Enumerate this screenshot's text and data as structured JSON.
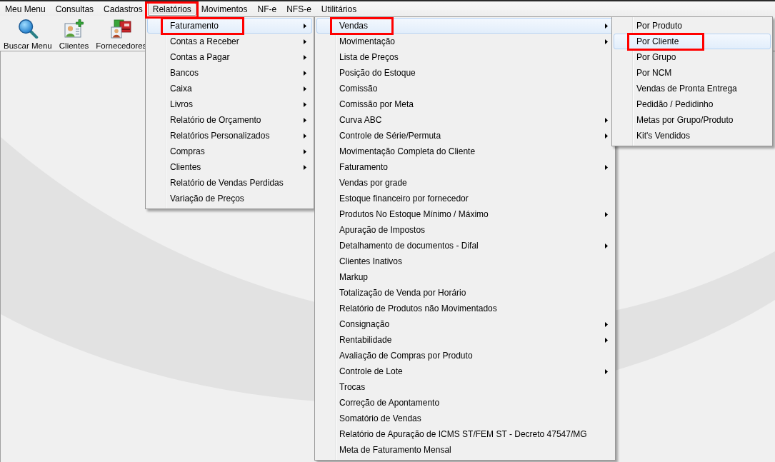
{
  "menu_bar": [
    {
      "label": "Meu Menu",
      "selected": false,
      "annotated": false
    },
    {
      "label": "Consultas",
      "selected": false,
      "annotated": false
    },
    {
      "label": "Cadastros",
      "selected": false,
      "annotated": false
    },
    {
      "label": "Relatórios",
      "selected": true,
      "annotated": true
    },
    {
      "label": "Movimentos",
      "selected": false,
      "annotated": false
    },
    {
      "label": "NF-e",
      "selected": false,
      "annotated": false
    },
    {
      "label": "NFS-e",
      "selected": false,
      "annotated": false
    },
    {
      "label": "Utilitários",
      "selected": false,
      "annotated": false
    }
  ],
  "toolbar": [
    {
      "label": "Buscar Menu",
      "kind": "search"
    },
    {
      "label": "Clientes",
      "kind": "client"
    },
    {
      "label": "Fornecedores",
      "kind": "supplier"
    }
  ],
  "menus": [
    {
      "items": [
        {
          "label": "Faturamento",
          "selected": true,
          "submenu": true,
          "annotated": true
        },
        {
          "label": "Contas a Receber",
          "selected": false,
          "submenu": true,
          "annotated": false
        },
        {
          "label": "Contas a Pagar",
          "selected": false,
          "submenu": true,
          "annotated": false
        },
        {
          "label": "Bancos",
          "selected": false,
          "submenu": true,
          "annotated": false
        },
        {
          "label": "Caixa",
          "selected": false,
          "submenu": true,
          "annotated": false
        },
        {
          "label": "Livros",
          "selected": false,
          "submenu": true,
          "annotated": false
        },
        {
          "label": "Relatório de Orçamento",
          "selected": false,
          "submenu": true,
          "annotated": false
        },
        {
          "label": "Relatórios Personalizados",
          "selected": false,
          "submenu": true,
          "annotated": false
        },
        {
          "label": "Compras",
          "selected": false,
          "submenu": true,
          "annotated": false
        },
        {
          "label": "Clientes",
          "selected": false,
          "submenu": true,
          "annotated": false
        },
        {
          "label": "Relatório de Vendas Perdidas",
          "selected": false,
          "submenu": false,
          "annotated": false
        },
        {
          "label": "Variação de Preços",
          "selected": false,
          "submenu": false,
          "annotated": false
        }
      ]
    },
    {
      "items": [
        {
          "label": "Vendas",
          "selected": true,
          "submenu": true,
          "annotated": true
        },
        {
          "label": "Movimentação",
          "selected": false,
          "submenu": true,
          "annotated": false
        },
        {
          "label": "Lista de Preços",
          "selected": false,
          "submenu": false,
          "annotated": false
        },
        {
          "label": "Posição do Estoque",
          "selected": false,
          "submenu": false,
          "annotated": false
        },
        {
          "label": "Comissão",
          "selected": false,
          "submenu": false,
          "annotated": false
        },
        {
          "label": "Comissão por Meta",
          "selected": false,
          "submenu": false,
          "annotated": false
        },
        {
          "label": "Curva ABC",
          "selected": false,
          "submenu": true,
          "annotated": false
        },
        {
          "label": "Controle de Série/Permuta",
          "selected": false,
          "submenu": true,
          "annotated": false
        },
        {
          "label": "Movimentação Completa do Cliente",
          "selected": false,
          "submenu": false,
          "annotated": false
        },
        {
          "label": "Faturamento",
          "selected": false,
          "submenu": true,
          "annotated": false
        },
        {
          "label": "Vendas por grade",
          "selected": false,
          "submenu": false,
          "annotated": false
        },
        {
          "label": "Estoque financeiro por fornecedor",
          "selected": false,
          "submenu": false,
          "annotated": false
        },
        {
          "label": "Produtos No Estoque Mínimo / Máximo",
          "selected": false,
          "submenu": true,
          "annotated": false
        },
        {
          "label": "Apuração de Impostos",
          "selected": false,
          "submenu": false,
          "annotated": false
        },
        {
          "label": "Detalhamento de documentos - Difal",
          "selected": false,
          "submenu": true,
          "annotated": false
        },
        {
          "label": "Clientes Inativos",
          "selected": false,
          "submenu": false,
          "annotated": false
        },
        {
          "label": "Markup",
          "selected": false,
          "submenu": false,
          "annotated": false
        },
        {
          "label": "Totalização de Venda por Horário",
          "selected": false,
          "submenu": false,
          "annotated": false
        },
        {
          "label": "Relatório de Produtos não Movimentados",
          "selected": false,
          "submenu": false,
          "annotated": false
        },
        {
          "label": "Consignação",
          "selected": false,
          "submenu": true,
          "annotated": false
        },
        {
          "label": "Rentabilidade",
          "selected": false,
          "submenu": true,
          "annotated": false
        },
        {
          "label": "Avaliação de Compras por Produto",
          "selected": false,
          "submenu": false,
          "annotated": false
        },
        {
          "label": "Controle de Lote",
          "selected": false,
          "submenu": true,
          "annotated": false
        },
        {
          "label": "Trocas",
          "selected": false,
          "submenu": false,
          "annotated": false
        },
        {
          "label": "Correção de Apontamento",
          "selected": false,
          "submenu": false,
          "annotated": false
        },
        {
          "label": "Somatório de Vendas",
          "selected": false,
          "submenu": false,
          "annotated": false
        },
        {
          "label": "Relatório de Apuração de ICMS ST/FEM ST - Decreto 47547/MG",
          "selected": false,
          "submenu": false,
          "annotated": false
        },
        {
          "label": "Meta de Faturamento Mensal",
          "selected": false,
          "submenu": false,
          "annotated": false
        }
      ]
    },
    {
      "items": [
        {
          "label": "Por Produto",
          "selected": false,
          "submenu": false,
          "annotated": false
        },
        {
          "label": "Por Cliente",
          "selected": true,
          "submenu": false,
          "annotated": true
        },
        {
          "label": "Por Grupo",
          "selected": false,
          "submenu": false,
          "annotated": false
        },
        {
          "label": "Por NCM",
          "selected": false,
          "submenu": false,
          "annotated": false
        },
        {
          "label": "Vendas de Pronta Entrega",
          "selected": false,
          "submenu": false,
          "annotated": false
        },
        {
          "label": "Pedidão / Pedidinho",
          "selected": false,
          "submenu": false,
          "annotated": false
        },
        {
          "label": "Metas por Grupo/Produto",
          "selected": false,
          "submenu": false,
          "annotated": false
        },
        {
          "label": "Kit's Vendidos",
          "selected": false,
          "submenu": false,
          "annotated": false
        }
      ]
    }
  ]
}
